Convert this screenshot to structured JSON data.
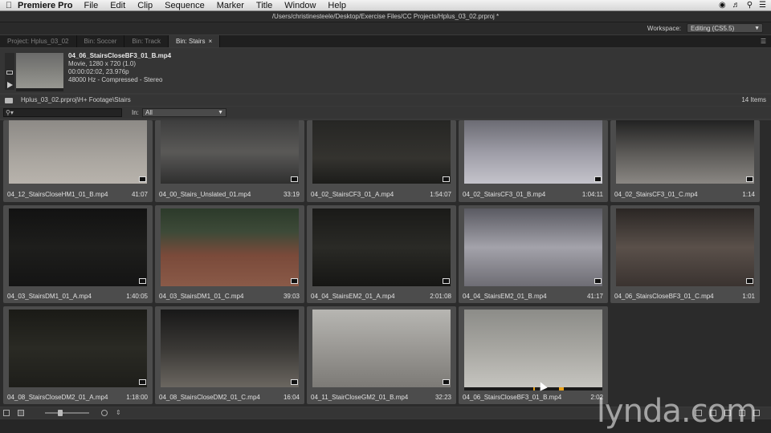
{
  "menubar": {
    "app_name": "Premiere Pro",
    "items": [
      "File",
      "Edit",
      "Clip",
      "Sequence",
      "Marker",
      "Title",
      "Window",
      "Help"
    ]
  },
  "window": {
    "title": "/Users/christinesteele/Desktop/Exercise Files/CC Projects/Hplus_03_02.prproj *"
  },
  "workspace": {
    "label": "Workspace:",
    "value": "Editing (CS5.5)"
  },
  "tabs": [
    {
      "label": "Project: Hplus_03_02",
      "active": false
    },
    {
      "label": "Bin: Soccer",
      "active": false
    },
    {
      "label": "Bin: Track",
      "active": false
    },
    {
      "label": "Bin: Stairs",
      "active": true
    }
  ],
  "preview": {
    "name": "04_06_StairsCloseBF3_01_B.mp4",
    "line1": "Movie, 1280 x 720 (1.0)",
    "line2": "00:00:02:02, 23.976p",
    "line3": "48000 Hz - Compressed - Stereo"
  },
  "bin": {
    "path": "Hplus_03_02.prproj\\H+ Footage\\Stairs",
    "count": "14 Items",
    "search_placeholder": "",
    "in_label": "In:",
    "in_value": "All"
  },
  "clips": [
    {
      "name": "04_12_StairsCloseHM1_01_B.mp4",
      "duration": "41:07"
    },
    {
      "name": "04_00_Stairs_Unslated_01.mp4",
      "duration": "33:19"
    },
    {
      "name": "04_02_StairsCF3_01_A.mp4",
      "duration": "1:54:07"
    },
    {
      "name": "04_02_StairsCF3_01_B.mp4",
      "duration": "1:04:11"
    },
    {
      "name": "04_02_StairsCF3_01_C.mp4",
      "duration": "1:14"
    },
    {
      "name": "04_03_StairsDM1_01_A.mp4",
      "duration": "1:40:05"
    },
    {
      "name": "04_03_StairsDM1_01_C.mp4",
      "duration": "39:03"
    },
    {
      "name": "04_04_StairsEM2_01_A.mp4",
      "duration": "2:01:08"
    },
    {
      "name": "04_04_StairsEM2_01_B.mp4",
      "duration": "41:17"
    },
    {
      "name": "04_06_StairsCloseBF3_01_C.mp4",
      "duration": "1:01"
    },
    {
      "name": "04_08_StairsCloseDM2_01_A.mp4",
      "duration": "1:18:00"
    },
    {
      "name": "04_08_StairsCloseDM2_01_C.mp4",
      "duration": "16:04"
    },
    {
      "name": "04_11_StairCloseGM2_01_B.mp4",
      "duration": "32:23"
    },
    {
      "name": "04_06_StairsCloseBF3_01_B.mp4",
      "duration": "2:02"
    }
  ],
  "watermark": "lynda.com"
}
